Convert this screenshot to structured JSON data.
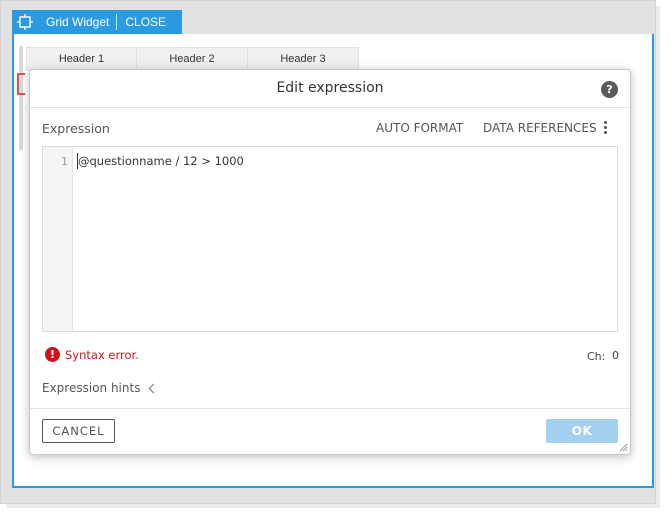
{
  "widget": {
    "title": "Grid Widget",
    "close_label": "CLOSE",
    "headers": [
      "Header 1",
      "Header 2",
      "Header 3"
    ]
  },
  "dialog": {
    "title": "Edit expression",
    "help_glyph": "?",
    "expression_label": "Expression",
    "auto_format_label": "AUTO FORMAT",
    "data_references_label": "DATA REFERENCES",
    "editor": {
      "line_number": "1",
      "code": "@questionname / 12 > 1000"
    },
    "error": {
      "glyph": "!",
      "text": "Syntax error."
    },
    "char_label": "Ch:",
    "char_value": "0",
    "hints_label": "Expression hints",
    "cancel_label": "CANCEL",
    "ok_label": "OK"
  },
  "colors": {
    "accent": "#2a9be0",
    "error": "#d0121b",
    "ok_disabled": "#a4d1ef"
  }
}
